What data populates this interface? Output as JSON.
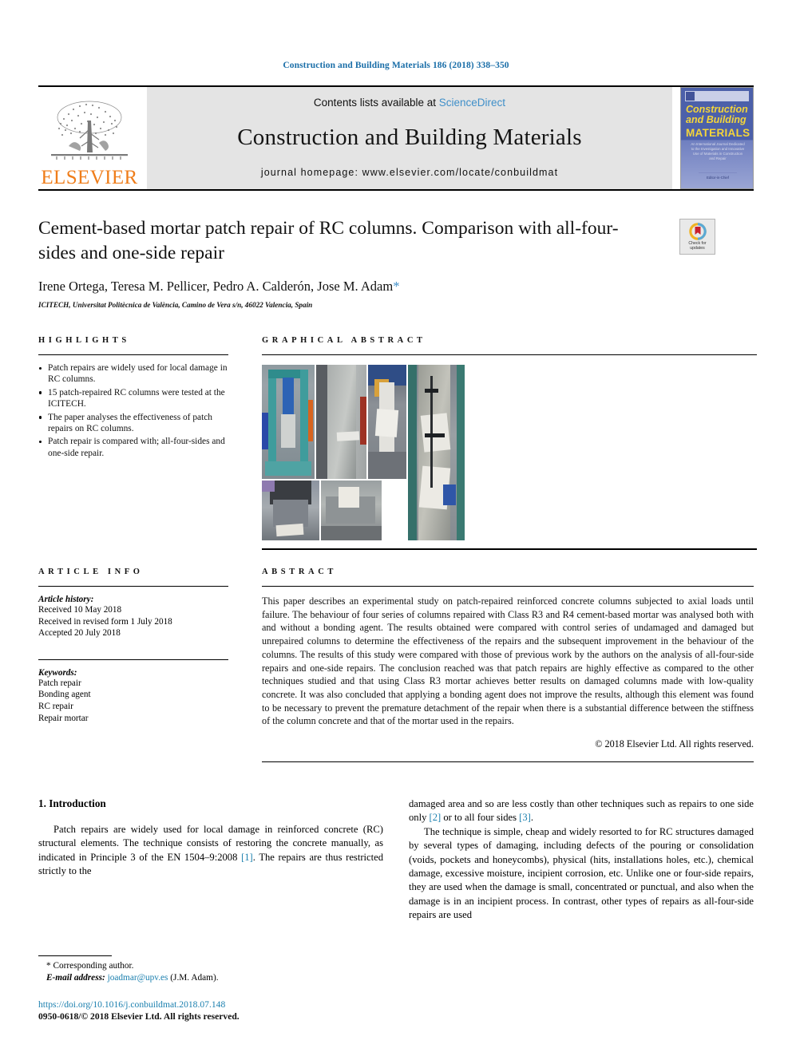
{
  "running_head": "Construction and Building Materials 186 (2018) 338–350",
  "masthead": {
    "publisher_name": "ELSEVIER",
    "contents_prefix": "Contents lists available at",
    "contents_link": "ScienceDirect",
    "journal_title": "Construction and Building Materials",
    "homepage": "journal homepage: www.elsevier.com/locate/conbuildmat",
    "cover": {
      "line1": "Construction",
      "line2": "and Building",
      "line3": "MATERIALS",
      "subtitle": "An International Journal Dedicated to the Investigation and Innovative Use of Materials in Construction and Repair",
      "footer": "Editor-in-Chief"
    }
  },
  "title": {
    "text": "Cement-based mortar patch repair of RC columns. Comparison with all-four-sides and one-side repair",
    "crossmark_line1": "Check for",
    "crossmark_line2": "updates"
  },
  "authors": {
    "names": "Irene Ortega, Teresa M. Pellicer, Pedro A. Calderón, Jose M. Adam",
    "corresponding_marker": "*",
    "affiliation": "ICITECH, Universitat Politècnica de València, Camino de Vera s/n, 46022 Valencia, Spain"
  },
  "highlights": {
    "heading": "HIGHLIGHTS",
    "items": [
      "Patch repairs are widely used for local damage in RC columns.",
      "15 patch-repaired RC columns were tested at the ICITECH.",
      "The paper analyses the effectiveness of patch repairs on RC columns.",
      "Patch repair is compared with; all-four-sides and one-side repair."
    ]
  },
  "graphical_abstract": {
    "heading": "GRAPHICAL ABSTRACT",
    "images": [
      "test-rig-photo",
      "column-surface-photo",
      "column-repair-detail-photo",
      "instrumented-column-photo",
      "column-crushed-top-photo",
      "concrete-spalling-photo"
    ]
  },
  "article_info": {
    "heading": "ARTICLE INFO",
    "history_label": "Article history:",
    "history": [
      "Received 10 May 2018",
      "Received in revised form 1 July 2018",
      "Accepted 20 July 2018"
    ],
    "keywords_label": "Keywords:",
    "keywords": [
      "Patch repair",
      "Bonding agent",
      "RC repair",
      "Repair mortar"
    ]
  },
  "abstract": {
    "heading": "ABSTRACT",
    "body": "This paper describes an experimental study on patch-repaired reinforced concrete columns subjected to axial loads until failure. The behaviour of four series of columns repaired with Class R3 and R4 cement-based mortar was analysed both with and without a bonding agent. The results obtained were compared with control series of undamaged and damaged but unrepaired columns to determine the effectiveness of the repairs and the subsequent improvement in the behaviour of the columns. The results of this study were compared with those of previous work by the authors on the analysis of all-four-side repairs and one-side repairs. The conclusion reached was that patch repairs are highly effective as compared to the other techniques studied and that using Class R3 mortar achieves better results on damaged columns made with low-quality concrete. It was also concluded that applying a bonding agent does not improve the results, although this element was found to be necessary to prevent the premature detachment of the repair when there is a substantial difference between the stiffness of the column concrete and that of the mortar used in the repairs.",
    "copyright": "© 2018 Elsevier Ltd. All rights reserved."
  },
  "body": {
    "section_heading": "1. Introduction",
    "left_para_1_a": "Patch repairs are widely used for local damage in reinforced concrete (RC) structural elements. The technique consists of restoring the concrete manually, as indicated in Principle 3 of the EN 1504–9:2008 ",
    "ref1": "[1]",
    "left_para_1_b": ". The repairs are thus restricted strictly to the ",
    "right_para_1_a": "damaged area and so are less costly than other techniques such as repairs to one side only ",
    "ref2": "[2]",
    "right_para_1_b": " or to all four sides ",
    "ref3": "[3]",
    "right_para_1_c": ".",
    "right_para_2": "The technique is simple, cheap and widely resorted to for RC structures damaged by several types of damaging, including defects of the pouring or consolidation (voids, pockets and honeycombs), physical (hits, installations holes, etc.), chemical damage, excessive moisture, incipient corrosion, etc. Unlike one or four-side repairs, they are used when the damage is small, concentrated or punctual, and also when the damage is in an incipient process. In contrast, other types of repairs as all-four-side repairs are used"
  },
  "footnote": {
    "corresponding": "* Corresponding author.",
    "email_label": "E-mail address:",
    "email": "joadmar@upv.es",
    "email_suffix": "(J.M. Adam).",
    "doi": "https://doi.org/10.1016/j.conbuildmat.2018.07.148",
    "issn": "0950-0618/© 2018 Elsevier Ltd. All rights reserved."
  },
  "colors": {
    "link_blue": "#1a7fae",
    "elsevier_orange": "#ef7d1a",
    "sciencedirect_blue": "#3f8fc9",
    "masthead_gray": "#e4e4e4"
  }
}
